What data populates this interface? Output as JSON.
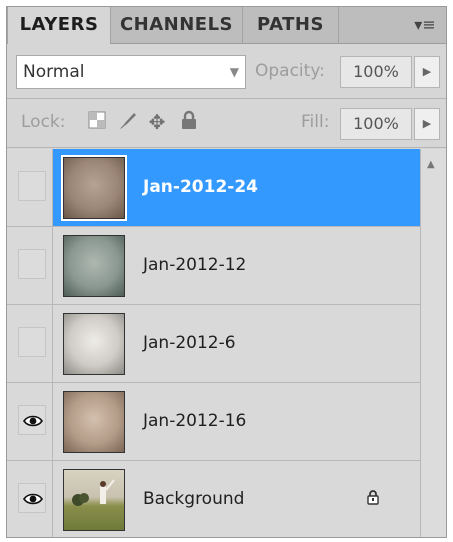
{
  "tabs": [
    {
      "label": "LAYERS",
      "active": true
    },
    {
      "label": "CHANNELS",
      "active": false
    },
    {
      "label": "PATHS",
      "active": false
    }
  ],
  "menu_icon": "panel-menu-icon",
  "blend_mode": "Normal",
  "opacity": {
    "label": "Opacity:",
    "value": "100%"
  },
  "lock": {
    "label": "Lock:",
    "icons": [
      "lock-transparent-pixels-icon",
      "lock-image-pixels-icon",
      "lock-position-icon",
      "lock-all-icon"
    ]
  },
  "fill": {
    "label": "Fill:",
    "value": "100%"
  },
  "layers": [
    {
      "name": "Jan-2012-24",
      "visible": false,
      "selected": true,
      "locked": false,
      "thumb_colors": [
        "#7d6a5c",
        "#b6a394"
      ]
    },
    {
      "name": "Jan-2012-12",
      "visible": false,
      "selected": false,
      "locked": false,
      "thumb_colors": [
        "#5a6b64",
        "#aeb8b1"
      ]
    },
    {
      "name": "Jan-2012-6",
      "visible": false,
      "selected": false,
      "locked": false,
      "thumb_colors": [
        "#8c8a86",
        "#e6e4df"
      ]
    },
    {
      "name": "Jan-2012-16",
      "visible": true,
      "selected": false,
      "locked": false,
      "thumb_colors": [
        "#8a6f5c",
        "#d4c0ae"
      ]
    },
    {
      "name": "Background",
      "visible": true,
      "selected": false,
      "locked": true,
      "thumb_colors": [
        "#6e7a3a",
        "#c8b07a"
      ]
    }
  ],
  "colors": {
    "selection": "#3399ff",
    "panel": "#d6d6d6"
  }
}
